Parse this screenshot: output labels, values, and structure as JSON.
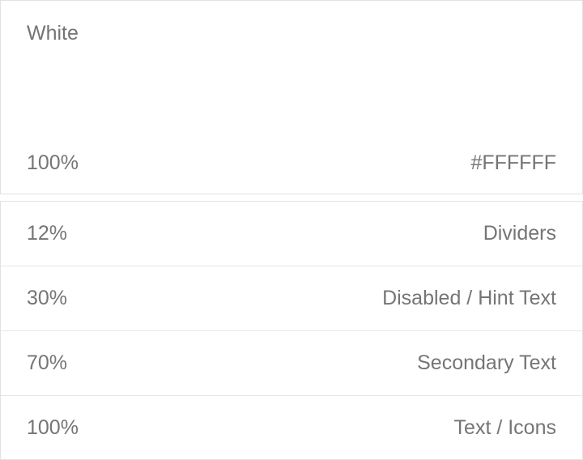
{
  "swatch": {
    "name": "White",
    "opacity": "100%",
    "hex": "#FFFFFF",
    "color": "#FFFFFF"
  },
  "usage": [
    {
      "opacity": "12%",
      "label": "Dividers"
    },
    {
      "opacity": "30%",
      "label": "Disabled / Hint Text"
    },
    {
      "opacity": "70%",
      "label": "Secondary Text"
    },
    {
      "opacity": "100%",
      "label": "Text / Icons"
    }
  ],
  "colors": {
    "text": "#757575",
    "border": "#E2E2E2"
  }
}
